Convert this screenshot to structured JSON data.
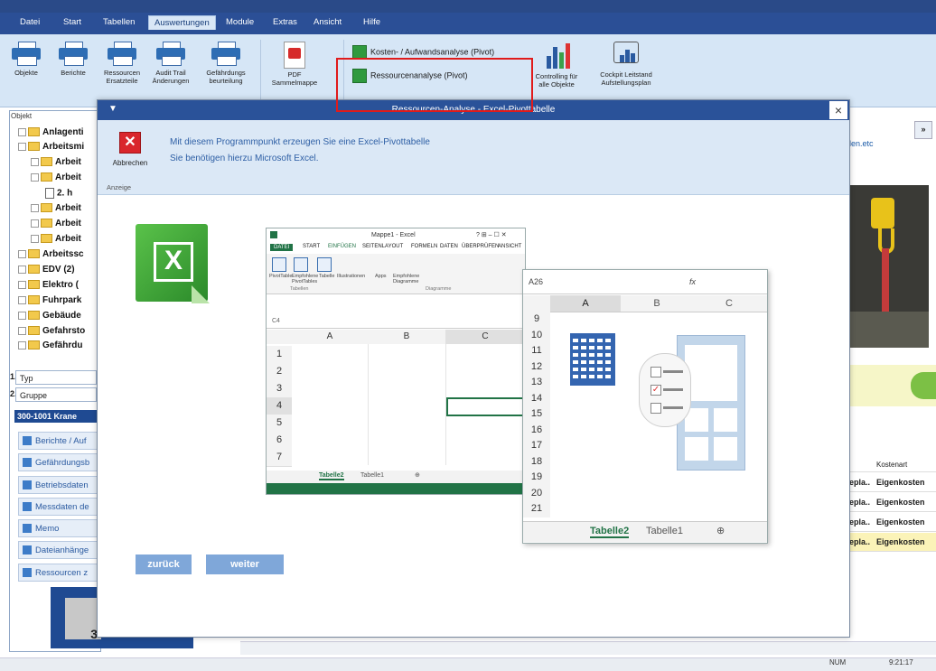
{
  "menubar": {
    "items": [
      "Datei",
      "Start",
      "Tabellen",
      "Auswertungen",
      "Module",
      "Extras",
      "Ansicht",
      "Hilfe"
    ],
    "active_index": 3
  },
  "ribbon": {
    "buttons": [
      {
        "label": "Objekte"
      },
      {
        "label": "Berichte"
      },
      {
        "label": "Ressourcen\nErsatzteile"
      },
      {
        "label": "Audit Trail\nÄnderungen"
      },
      {
        "label": "Gefährdungs\nbeurteilung"
      },
      {
        "label": "PDF\nSammelmappe"
      }
    ],
    "pivot_kosten": "Kosten- / Aufwandsanalyse (Pivot)",
    "pivot_ressourcen": "Ressourcenanalyse (Pivot)",
    "controlling": "Controlling für\nalle Objekte",
    "cockpit": "Cockpit Leitstand\nAufstellungsplan"
  },
  "left_panel": {
    "header": "Objekt",
    "tree": [
      {
        "label": "Anlagenti",
        "indent": 0
      },
      {
        "label": "Arbeitsmi",
        "indent": 0
      },
      {
        "label": "Arbeit",
        "indent": 1
      },
      {
        "label": "Arbeit",
        "indent": 1
      },
      {
        "label": "2. h",
        "indent": 2
      },
      {
        "label": "Arbeit",
        "indent": 1
      },
      {
        "label": "Arbeit",
        "indent": 1
      },
      {
        "label": "Arbeit",
        "indent": 1
      },
      {
        "label": "Arbeitssc",
        "indent": 0
      },
      {
        "label": "EDV  (2)",
        "indent": 0
      },
      {
        "label": "Elektro  (",
        "indent": 0
      },
      {
        "label": "Fuhrpark",
        "indent": 0
      },
      {
        "label": "Gebäude",
        "indent": 0
      },
      {
        "label": "Gefahrsto",
        "indent": 0
      },
      {
        "label": "Gefährdu",
        "indent": 0
      }
    ],
    "field_typ": "Typ",
    "field_typ_num": "1.",
    "field_gruppe": "Gruppe",
    "field_gruppe_num": "2.",
    "selected_group": "300-1001 Krane",
    "buttons": [
      "Berichte / Auf",
      "Gefährdungsb",
      "Betriebsdaten",
      "Messdaten de",
      "Memo",
      "Dateianhänge",
      "Ressourcen z"
    ],
    "block_text": "3"
  },
  "dialog": {
    "title": "Ressourcen-Analyse - Excel-Pivottabelle",
    "close": "×",
    "menu_icon": "▼",
    "abbrechen": "Abbrechen",
    "x_glyph": "✕",
    "anzeige": "Anzeige",
    "text1": "Mit diesem Programmpunkt erzeugen Sie eine  Excel-Pivottabelle",
    "text2": "Sie benötigen hierzu Microsoft Excel.",
    "back": "zurück",
    "next": "weiter"
  },
  "excel_logo": {
    "glyph": "X"
  },
  "excel_preview_1": {
    "window_title": "Mappe1 - Excel",
    "window_controls": "?  ⊞  –  ☐  ✕",
    "tabs": [
      "DATEI",
      "START",
      "EINFÜGEN",
      "SEITENLAYOUT",
      "FORMELN",
      "DATEN",
      "ÜBERPRÜFEN",
      "ANSICHT"
    ],
    "ribbon_items": [
      "PivotTable",
      "Empfohlene PivotTables",
      "Tabelle",
      "Illustrationen",
      "Apps",
      "Empfohlene Diagramme"
    ],
    "group_tabellen": "Tabellen",
    "group_diagramme": "Diagramme",
    "namebox": "C4",
    "columns": [
      "A",
      "B",
      "C"
    ],
    "rows": [
      "1",
      "2",
      "3",
      "4",
      "5",
      "6",
      "7"
    ],
    "sheets": [
      "Tabelle2",
      "Tabelle1"
    ],
    "add_sheet": "⊕"
  },
  "excel_preview_2": {
    "namebox": "A26",
    "fx": "fx",
    "columns": [
      "A",
      "B",
      "C"
    ],
    "rows": [
      "9",
      "10",
      "11",
      "12",
      "13",
      "14",
      "15",
      "16",
      "17",
      "18",
      "19",
      "20",
      "21"
    ],
    "sheets": [
      "Tabelle2",
      "Tabelle1"
    ],
    "add_sheet": "⊕"
  },
  "right_strip": {
    "expand": "»",
    "link": "len.etc",
    "table_header": "Kostenart",
    "rows": [
      {
        "a": "epla..",
        "b": "Eigenkosten",
        "highlight": false
      },
      {
        "a": "epla..",
        "b": "Eigenkosten",
        "highlight": false
      },
      {
        "a": "epla..",
        "b": "Eigenkosten",
        "highlight": false
      },
      {
        "a": "epla..",
        "b": "Eigenkosten",
        "highlight": true
      }
    ]
  },
  "statusbar": {
    "num": "NUM",
    "time": "9:21:17"
  },
  "colors": {
    "menubar": "#2b4f96",
    "dialog_title": "#2a5299",
    "excel_green": "#217346",
    "highlight_red": "#e01b1b"
  }
}
